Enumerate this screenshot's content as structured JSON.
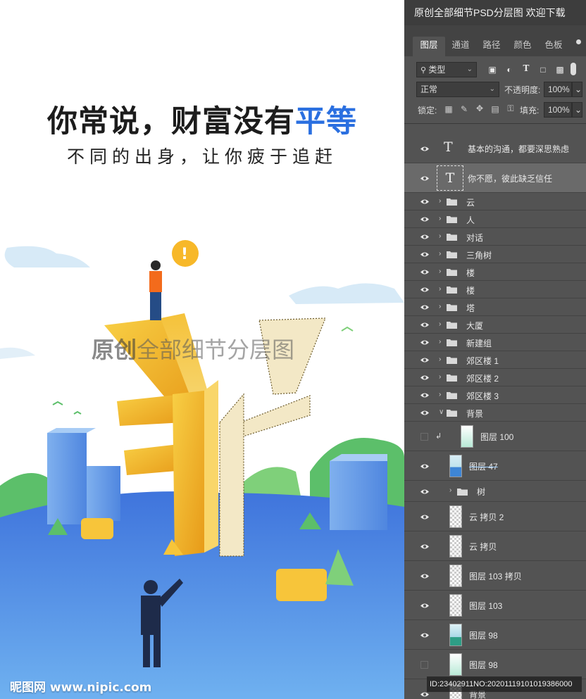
{
  "poster": {
    "headline_main": "你常说，财富没有",
    "headline_accent": "平等",
    "subline": "不同的出身，让你疲于追赶",
    "watermark_bold": "原创",
    "watermark_rest": "全部细节分层图",
    "credit": "昵图网 www.nipic.com",
    "colors": {
      "accent": "#2a6fe0",
      "ground": "#3f7de0",
      "gold": "#f2b327",
      "green": "#5cbf6a"
    }
  },
  "ps": {
    "title": "原创全部细节PSD分层图 欢迎下载",
    "tabs": [
      "图层",
      "通道",
      "路径",
      "颜色",
      "色板"
    ],
    "active_tab": "图层",
    "filter_label": "类型",
    "filter_icons": [
      "image-filter-icon",
      "adjustment-filter-icon",
      "type-filter-icon",
      "shape-filter-icon",
      "smart-object-filter-icon"
    ],
    "blend_mode": "正常",
    "opacity_label": "不透明度:",
    "opacity_value": "100%",
    "lock_label": "锁定:",
    "fill_label": "填充:",
    "fill_value": "100%",
    "layers": [
      {
        "kind": "text",
        "name": "基本的沟通，都要深思熟虑",
        "visible": true,
        "selected": false
      },
      {
        "kind": "text",
        "name": "你不愿，彼此缺乏信任",
        "visible": true,
        "selected": true
      },
      {
        "kind": "group",
        "name": "云",
        "visible": true
      },
      {
        "kind": "group",
        "name": "人",
        "visible": true
      },
      {
        "kind": "group",
        "name": "对话",
        "visible": true
      },
      {
        "kind": "group",
        "name": "三角树",
        "visible": true
      },
      {
        "kind": "group",
        "name": "楼",
        "visible": true
      },
      {
        "kind": "group",
        "name": "楼",
        "visible": true
      },
      {
        "kind": "group",
        "name": "塔",
        "visible": true
      },
      {
        "kind": "group",
        "name": "大厦",
        "visible": true
      },
      {
        "kind": "group",
        "name": "新建组",
        "visible": true
      },
      {
        "kind": "group",
        "name": "郊区楼 1",
        "visible": true
      },
      {
        "kind": "group",
        "name": "郊区楼 2",
        "visible": true
      },
      {
        "kind": "group",
        "name": "郊区楼 3",
        "visible": true
      },
      {
        "kind": "group-open",
        "name": "背景",
        "visible": true
      },
      {
        "kind": "pixel",
        "name": "图层 100",
        "visible": false,
        "thumb": "img-green",
        "clipped": true
      },
      {
        "kind": "pixel",
        "name": "图层 47",
        "visible": true,
        "thumb": "img-blue",
        "strike": true
      },
      {
        "kind": "group",
        "name": "树",
        "visible": true,
        "nested": true
      },
      {
        "kind": "pixel",
        "name": "云 拷贝 2",
        "visible": true,
        "thumb": ""
      },
      {
        "kind": "pixel",
        "name": "云 拷贝",
        "visible": true,
        "thumb": ""
      },
      {
        "kind": "pixel",
        "name": "图层 103 拷贝",
        "visible": true,
        "thumb": ""
      },
      {
        "kind": "pixel",
        "name": "图层 103",
        "visible": true,
        "thumb": ""
      },
      {
        "kind": "pixel",
        "name": "图层 98",
        "visible": true,
        "thumb": "img-mix"
      },
      {
        "kind": "pixel",
        "name": "图层 98",
        "visible": false,
        "thumb": "img-green"
      },
      {
        "kind": "pixel",
        "name": "背景",
        "visible": true,
        "thumb": ""
      }
    ],
    "footer_id": "ID:23402911NO:20201119101019386000"
  }
}
